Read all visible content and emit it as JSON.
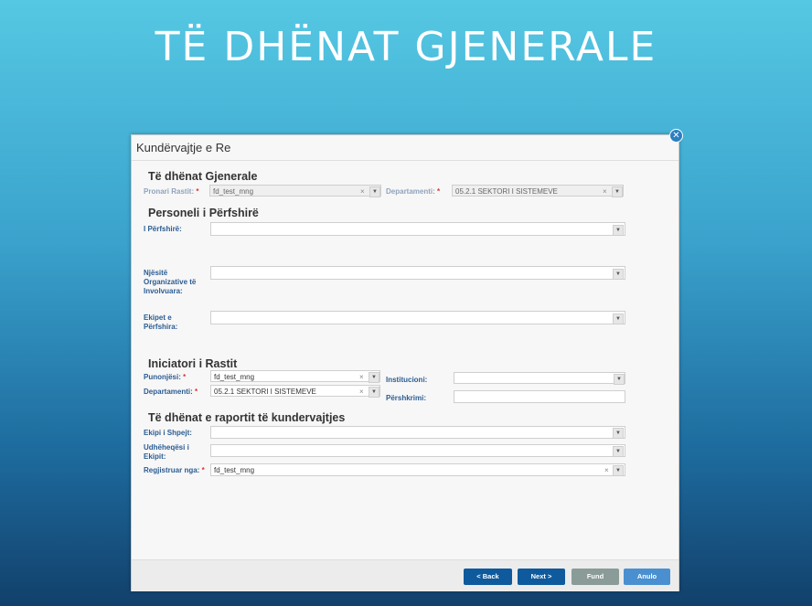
{
  "slide": {
    "title": "TË DHËNAT GJENERALE"
  },
  "dialog": {
    "title": "Kundërvajtje e Re"
  },
  "sections": {
    "general": "Të dhënat Gjenerale",
    "persons": "Personeli i Përfshirë",
    "initiator": "Iniciatori i Rastit",
    "report": "Të dhënat e raportit të kundervajtjes"
  },
  "labels": {
    "pronari": "Pronari Rastit:",
    "departamenti_top": "Departamenti:",
    "perfshire": "I Përfshirë:",
    "njesite": "Njësitë Organizative të Involvuara:",
    "ekipet": "Ekipet e Përfshira:",
    "punonjesi": "Punonjësi:",
    "departamenti": "Departamenti:",
    "institucioni": "Institucioni:",
    "pershkrimi": "Përshkrimi:",
    "ekipi_shpejt": "Ekipi i Shpejt:",
    "udheheqesi": "Udhëheqësi i Ekipit:",
    "regjistruar": "Regjistruar nga:",
    "required_mark": "*"
  },
  "values": {
    "pronari": "fd_test_mng",
    "departamenti_top": "05.2.1 SEKTORI I SISTEMEVE",
    "punonjesi": "fd_test_mng",
    "departamenti": "05.2.1 SEKTORI I SISTEMEVE",
    "regjistruar": "fd_test_mng"
  },
  "icons": {
    "clear": "×",
    "dropdown": "▼",
    "close": "✕"
  },
  "buttons": {
    "back": "< Back",
    "next": "Next >",
    "fund": "Fund",
    "anulo": "Anulo"
  },
  "colors": {
    "primary": "#0f5a9d",
    "disabled": "#8a9b98",
    "cancel": "#4a90d0"
  }
}
